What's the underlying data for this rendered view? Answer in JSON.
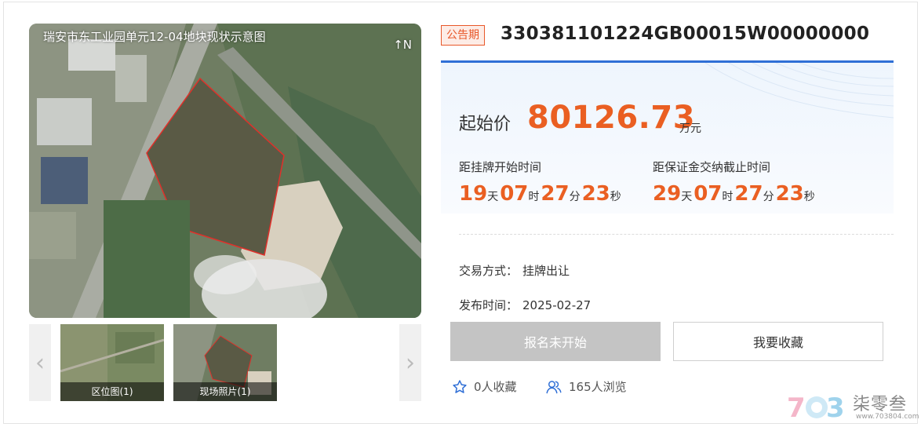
{
  "gallery": {
    "caption": "瑞安市东工业园单元12-04地块现状示意图",
    "north": "↑N",
    "thumbs": [
      {
        "label": "区位图(1)"
      },
      {
        "label": "现场照片(1)"
      }
    ],
    "prev_arrow": "‹",
    "next_arrow": "›"
  },
  "header": {
    "badge": "公告期",
    "code": "330381101224GB00015W00000000"
  },
  "price": {
    "label": "起始价",
    "value": "80126.73",
    "unit": "万元"
  },
  "countdowns": [
    {
      "title": "距挂牌开始时间",
      "days": "19",
      "hours": "07",
      "minutes": "27",
      "seconds": "23"
    },
    {
      "title": "距保证金交纳截止时间",
      "days": "29",
      "hours": "07",
      "minutes": "27",
      "seconds": "23"
    }
  ],
  "units": {
    "day": "天",
    "hour": "时",
    "minute": "分",
    "second": "秒"
  },
  "info": {
    "trade_key": "交易方式：",
    "trade_value": "挂牌出让",
    "publish_key": "发布时间：",
    "publish_value": "2025-02-27"
  },
  "actions": {
    "signup": "报名未开始",
    "favorite": "我要收藏"
  },
  "stats": {
    "favorites": "0人收藏",
    "views": "165人浏览"
  },
  "watermark": {
    "brand": "柒零叁",
    "site": "www.703804.com"
  },
  "colors": {
    "accent": "#ea5f22",
    "blue": "#2f6fd6",
    "parcel_outline": "#e0302a"
  }
}
